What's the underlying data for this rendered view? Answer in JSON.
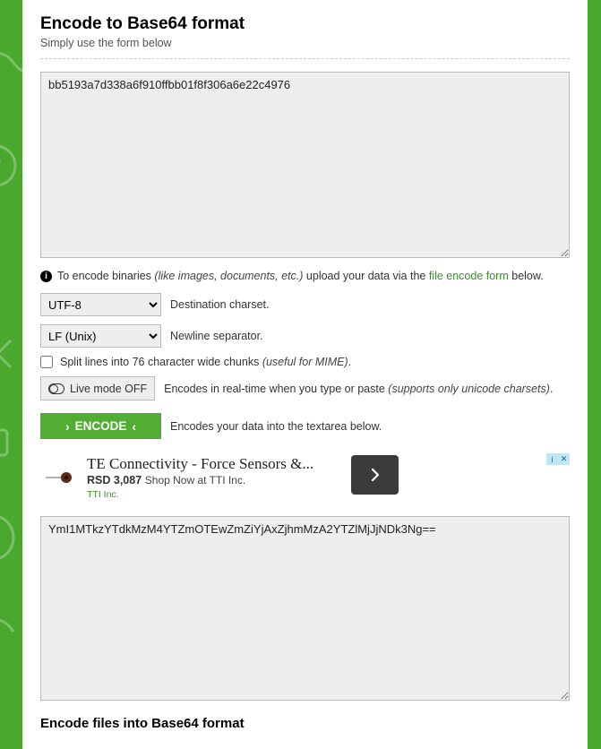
{
  "header": {
    "title": "Encode to Base64 format",
    "subtitle": "Simply use the form below"
  },
  "input": {
    "value": "bb5193a7d338a6f910ffbb01f8f306a6e22c4976"
  },
  "info": {
    "prefix": "To encode binaries ",
    "italic": "(like images, documents, etc.)",
    "mid": " upload your data via the ",
    "link": "file encode form",
    "suffix": " below."
  },
  "charset": {
    "selected": "UTF-8",
    "label": "Destination charset."
  },
  "newline": {
    "selected": "LF (Unix)",
    "label": "Newline separator."
  },
  "split": {
    "label": "Split lines into 76 character wide chunks ",
    "italic": "(useful for MIME)",
    "suffix": "."
  },
  "livemode": {
    "button": "Live mode OFF",
    "desc_plain": "Encodes in real-time when you type or paste ",
    "desc_italic": "(supports only unicode charsets)",
    "suffix": "."
  },
  "encode": {
    "button": "ENCODE",
    "desc": "Encodes your data into the textarea below."
  },
  "ad": {
    "title": "TE Connectivity - Force Sensors &...",
    "price": "RSD 3,087",
    "shop": "Shop Now at TTI Inc.",
    "company": "TTI Inc.",
    "badge_info": "i",
    "badge_close": "✕"
  },
  "output": {
    "value": "YmI1MTkzYTdkMzM4YTZmOTEwZmZiYjAxZjhmMzA2YTZlMjJjNDk3Ng=="
  },
  "next_section": "Encode files into Base64 format"
}
